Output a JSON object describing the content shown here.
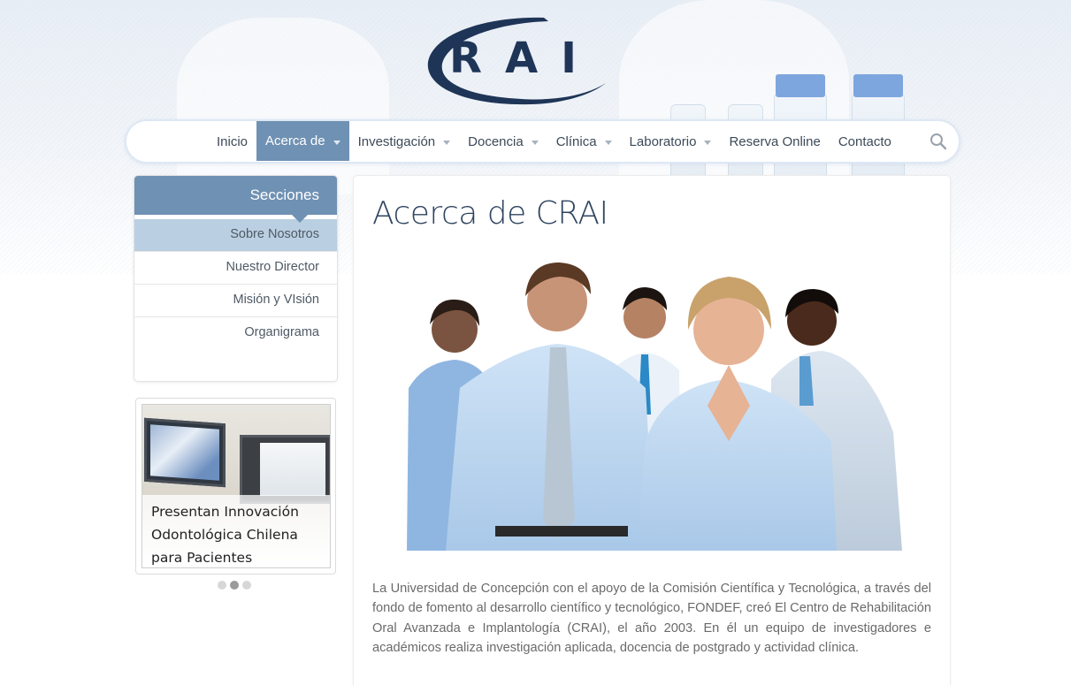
{
  "logo": {
    "text": "RAI",
    "brand_color": "#1e3557",
    "icon": "crai-logo-icon"
  },
  "nav": {
    "items": [
      {
        "label": "Inicio",
        "dropdown": false,
        "active": false
      },
      {
        "label": "Acerca de",
        "dropdown": true,
        "active": true
      },
      {
        "label": "Investigación",
        "dropdown": true,
        "active": false
      },
      {
        "label": "Docencia",
        "dropdown": true,
        "active": false
      },
      {
        "label": "Clínica",
        "dropdown": true,
        "active": false
      },
      {
        "label": "Laboratorio",
        "dropdown": true,
        "active": false
      },
      {
        "label": "Reserva Online",
        "dropdown": false,
        "active": false
      },
      {
        "label": "Contacto",
        "dropdown": false,
        "active": false
      }
    ],
    "search_icon": "search-icon",
    "accent_color": "#6f91b3"
  },
  "sidebar": {
    "title": "Secciones",
    "items": [
      {
        "label": "Sobre Nosotros",
        "active": true
      },
      {
        "label": "Nuestro Director",
        "active": false
      },
      {
        "label": "Misión y VIsión",
        "active": false
      },
      {
        "label": "Organigrama",
        "active": false
      }
    ]
  },
  "news": {
    "caption": "Presentan Innovación Odontológica Chilena para Pacientes",
    "slide_count": 3,
    "active_slide": 2
  },
  "main": {
    "title": "Acerca de CRAI",
    "body": "La Universidad de Concepción con el apoyo de la Comisión Científica y Tecnológica, a través del fondo de fomento al desarrollo científico y tecnológico, FONDEF, creó El Centro de Rehabilitación Oral Avanzada e Implantología (CRAI), el año 2003. En él un equipo de investigadores e académicos realiza investigación aplicada, docencia de postgrado y actividad clínica."
  }
}
